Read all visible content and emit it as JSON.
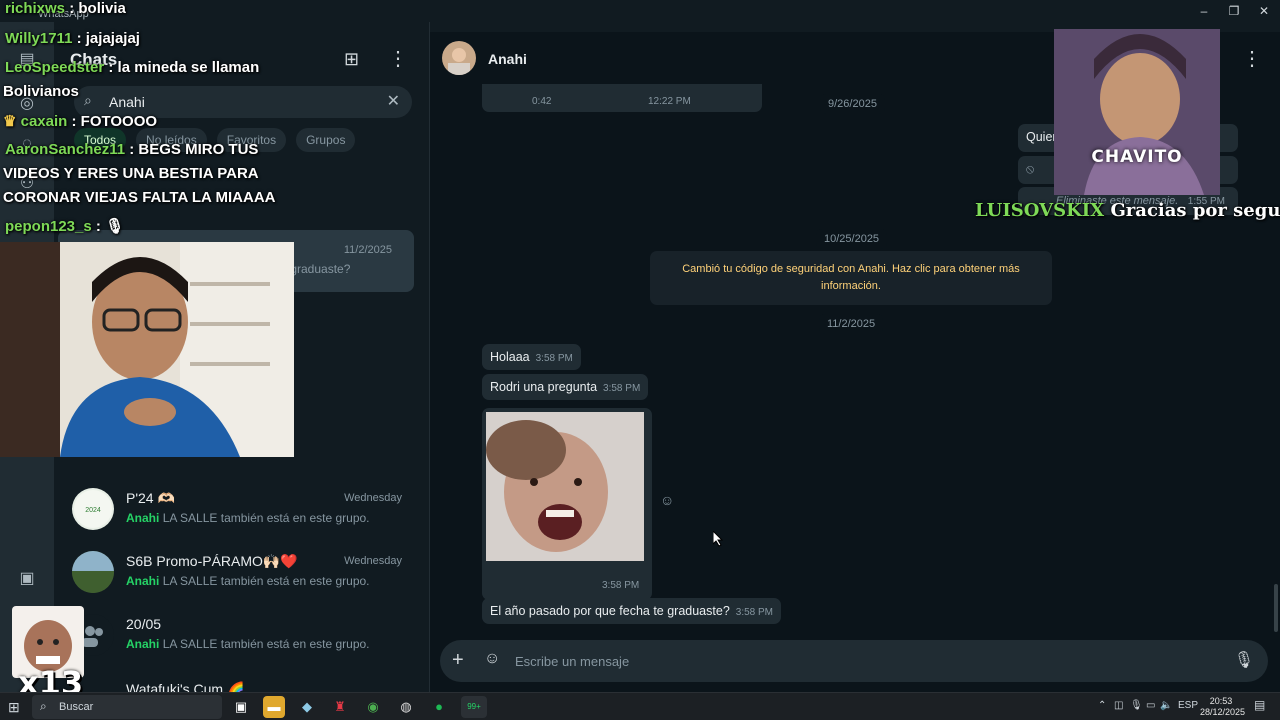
{
  "window": {
    "app_title": "WhatsApp"
  },
  "chatlist": {
    "title": "Chats",
    "search_value": "Anahi",
    "filters": [
      "Todos",
      "No leídos",
      "Favoritos",
      "Grupos"
    ],
    "selected_item": {
      "time": "11/2/2025",
      "preview": "¿graduaste?"
    },
    "items": [
      {
        "name": "P'24 🫶🏻",
        "time": "Wednesday",
        "sender": "Anahi",
        "text": "LA SALLE también está en este grupo."
      },
      {
        "name": "S6B Promo-PÁRAMO🙌🏻❤️",
        "time": "Wednesday",
        "sender": "Anahi",
        "text": "LA SALLE también está en este grupo."
      },
      {
        "name": "20/05",
        "time": "",
        "sender": "Anahi",
        "text": "LA SALLE también está en este grupo."
      },
      {
        "name": "Watafuki's Cum 🌈",
        "time": "",
        "sender": "",
        "text": ""
      }
    ]
  },
  "chat": {
    "contact_name": "Anahi",
    "audio_duration": "0:42",
    "audio_time": "12:22 PM",
    "dates": [
      "9/26/2025",
      "10/25/2025",
      "11/2/2025"
    ],
    "system_message": "Cambió tu código de seguridad con Anahi. Haz clic para obtener más información.",
    "partial_messages": [
      "Quien",
      "Eliminaste este mensaje.",
      "1:55 PM"
    ],
    "messages": [
      {
        "text": "Holaaa",
        "time": "3:58 PM"
      },
      {
        "text": "Rodri una pregunta",
        "time": "3:58 PM"
      },
      {
        "text": "",
        "time": "3:58 PM"
      },
      {
        "text": "El año pasado por que fecha te graduaste?",
        "time": "3:58 PM"
      }
    ],
    "composer_placeholder": "Escribe un mensaje"
  },
  "overlay": {
    "chat": [
      {
        "user": "richixws",
        "text": "bolivia"
      },
      {
        "user": "Willy1711",
        "text": "jajajajaj"
      },
      {
        "user": "LeoSpeedster",
        "text": "la mineda se llaman"
      },
      {
        "user": "",
        "text": "Bolivianos"
      },
      {
        "user": "caxain",
        "text": "FOTOOOO"
      },
      {
        "user": "AaronSanchez11",
        "text": "BEGS MIRO TUS"
      },
      {
        "user": "",
        "text": "VIDEOS Y ERES UNA BESTIA PARA"
      },
      {
        "user": "",
        "text": "CORONAR VIEJAS FALTA LA MIAAAA"
      },
      {
        "user": "pepon123_s",
        "text": "🎙"
      }
    ],
    "cam2_label": "CHAVITO",
    "follow_user": "LUISOVSKIX",
    "follow_text": "Gracias por seguirme",
    "sticker_count": "x13"
  },
  "taskbar": {
    "search_label": "Buscar",
    "whatsapp_badge": "99+",
    "lang": "ESP",
    "time": "20:53",
    "date": "28/12/2025"
  },
  "colors": {
    "accent": "#25d366",
    "bg": "#111b21",
    "chat_bg": "#0b141a",
    "bubble": "#202c33",
    "system_text": "#ffd279"
  }
}
